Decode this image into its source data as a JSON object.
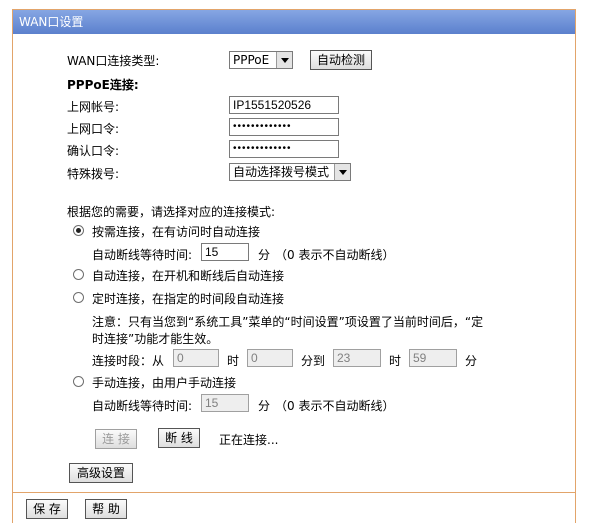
{
  "window": {
    "title": "WAN口设置"
  },
  "form": {
    "wan_type_label": "WAN口连接类型:",
    "wan_type_value": "PPPoE",
    "auto_detect_button": "自动检测",
    "pppoe_section_label": "PPPoE连接:",
    "account_label": "上网帐号:",
    "account_value": "IP1551520526",
    "password_label": "上网口令:",
    "password_value": "•••••••••••••",
    "confirm_label": "确认口令:",
    "confirm_value": "•••••••••••••",
    "dial_label": "特殊拨号:",
    "dial_value": "自动选择拨号模式"
  },
  "modes": {
    "prompt": "根据您的需要，请选择对应的连接模式:",
    "on_demand": {
      "label": "按需连接，在有访问时自动连接",
      "checked": true,
      "idle_label": "自动断线等待时间:",
      "idle_value": "15",
      "idle_unit": "分",
      "idle_hint": "（0 表示不自动断线）"
    },
    "auto": {
      "label": "自动连接，在开机和断线后自动连接",
      "checked": false
    },
    "timed": {
      "label": "定时连接，在指定的时间段自动连接",
      "checked": false,
      "note_line1": "注意：只有当您到“系统工具”菜单的“时间设置”项设置了当前时间后，“定",
      "note_line2": "时连接”功能才能生效。",
      "period_label": "连接时段：从",
      "from_hour": "0",
      "hour_label": "时",
      "from_min": "0",
      "to_label": "分到",
      "to_hour": "23",
      "hour_label2": "时",
      "to_min": "59",
      "min_label": "分"
    },
    "manual": {
      "label": "手动连接，由用户手动连接",
      "checked": false,
      "idle_label": "自动断线等待时间:",
      "idle_value": "15",
      "idle_unit": "分",
      "idle_hint": "（0 表示不自动断线）"
    }
  },
  "actions": {
    "connect_button": "连 接",
    "disconnect_button": "断 线",
    "status_text": "正在连接...",
    "advanced_button": "高级设置"
  },
  "footer": {
    "save_button": "保 存",
    "help_button": "帮 助"
  },
  "colors": {
    "titlebar": "#6a8fd6",
    "border": "#e2a46a"
  }
}
